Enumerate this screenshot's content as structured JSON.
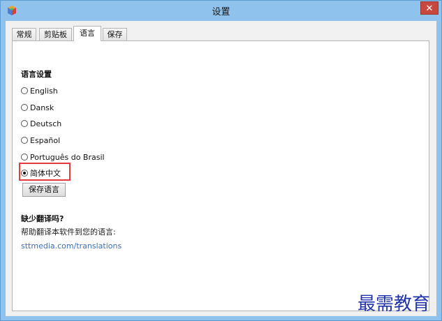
{
  "window": {
    "title": "设置",
    "close_label": "✕"
  },
  "tabs": [
    {
      "label": "常规"
    },
    {
      "label": "剪贴板"
    },
    {
      "label": "语言",
      "active": true
    },
    {
      "label": "保存"
    }
  ],
  "language_section": {
    "title": "语言设置",
    "options": [
      {
        "label": "English",
        "selected": false
      },
      {
        "label": "Dansk",
        "selected": false
      },
      {
        "label": "Deutsch",
        "selected": false
      },
      {
        "label": "Español",
        "selected": false
      },
      {
        "label": "Português do Brasil",
        "selected": false
      },
      {
        "label": "简体中文",
        "selected": true
      }
    ],
    "save_button": "保存语言"
  },
  "translation_section": {
    "title": "缺少翻译吗?",
    "text": "帮助翻译本软件到您的语言:",
    "link": "sttmedia.com/translations"
  },
  "watermark": "最需教育",
  "colors": {
    "highlight": "#e33b3b",
    "link": "#3b6fb6",
    "titlebar": "#8fc3ee",
    "close": "#c7483f"
  }
}
